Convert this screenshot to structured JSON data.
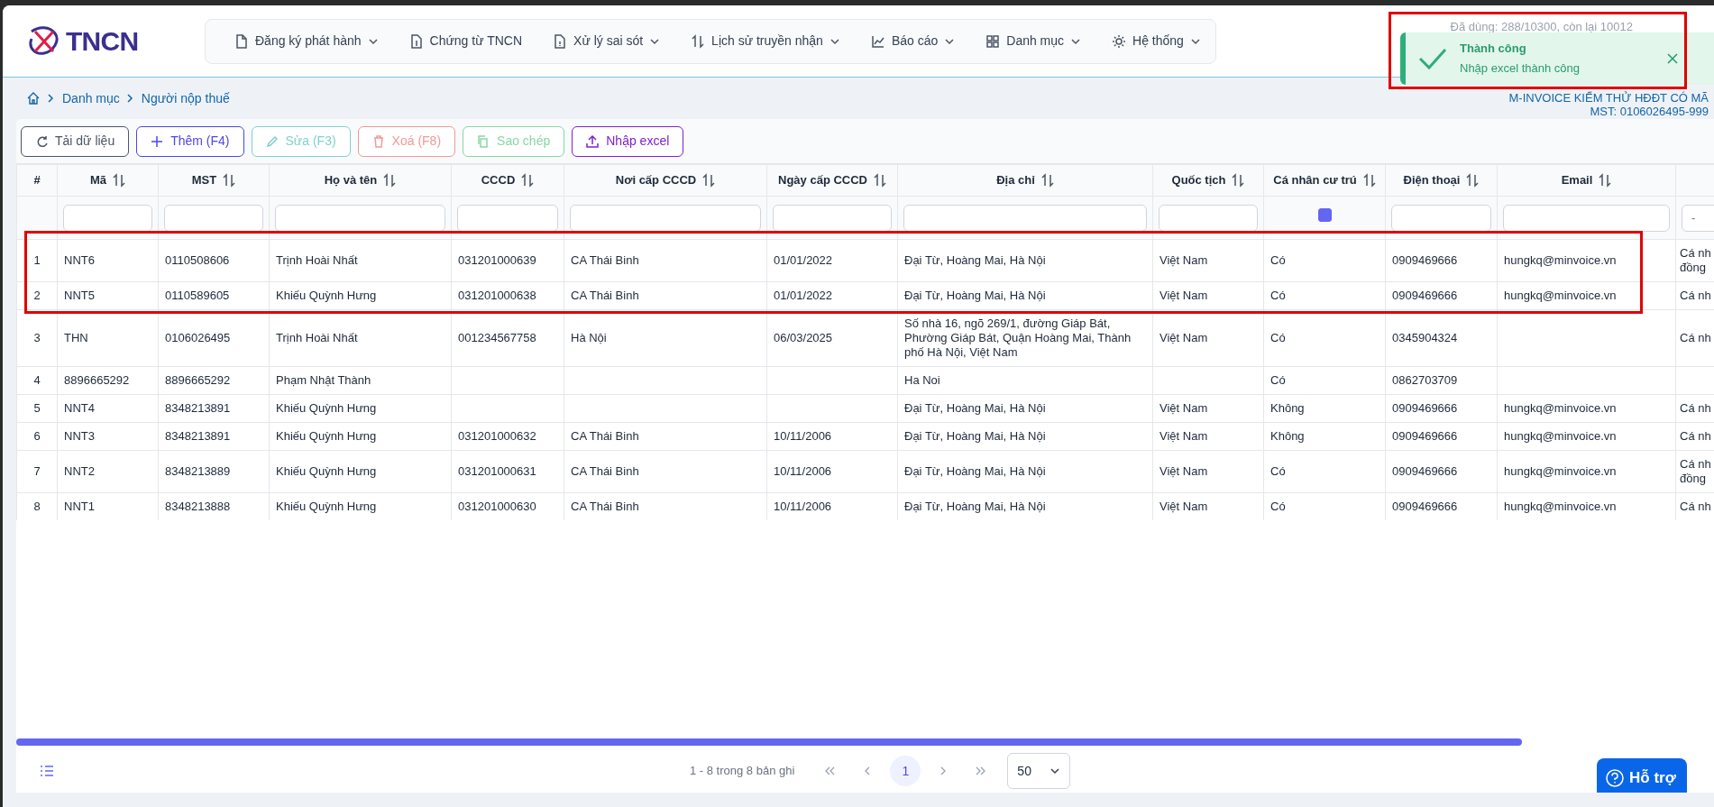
{
  "header": {
    "logo": "TNCN",
    "nav": [
      {
        "label": "Đăng ký phát hành",
        "has_dropdown": true
      },
      {
        "label": "Chứng từ TNCN",
        "has_dropdown": false
      },
      {
        "label": "Xử lý sai sót",
        "has_dropdown": true
      },
      {
        "label": "Lịch sử truyền nhận",
        "has_dropdown": true
      },
      {
        "label": "Báo cáo",
        "has_dropdown": true
      },
      {
        "label": "Danh mục",
        "has_dropdown": true
      },
      {
        "label": "Hệ thống",
        "has_dropdown": true
      }
    ],
    "usage": "Đã dùng: 288/10300, còn lại 10012"
  },
  "toast": {
    "title": "Thành công",
    "message": "Nhập excel thành công"
  },
  "breadcrumb": [
    "Danh mục",
    "Người nộp thuế"
  ],
  "company": {
    "name": "M-INVOICE KIỂM THỬ HĐĐT CÓ MÃ",
    "tax_code": "MST: 0106026495-999"
  },
  "toolbar": [
    {
      "label": "Tải dữ liệu",
      "color": "#4b5563"
    },
    {
      "label": "Thêm (F4)",
      "color": "#4f46e5"
    },
    {
      "label": "Sửa (F3)",
      "color": "#7fd3c9"
    },
    {
      "label": "Xoá (F8)",
      "color": "#f19999"
    },
    {
      "label": "Sao chép",
      "color": "#86d7a4"
    },
    {
      "label": "Nhập excel",
      "color": "#7e22ce"
    }
  ],
  "table": {
    "columns": [
      {
        "label": "#",
        "sortable": false
      },
      {
        "label": "Mã",
        "sortable": true,
        "filter": {
          "kind": "text"
        }
      },
      {
        "label": "MST",
        "sortable": true,
        "filter": {
          "kind": "text"
        }
      },
      {
        "label": "Họ và tên",
        "sortable": true,
        "filter": {
          "kind": "text"
        }
      },
      {
        "label": "CCCD",
        "sortable": true,
        "filter": {
          "kind": "text"
        }
      },
      {
        "label": "Nơi cấp CCCD",
        "sortable": true,
        "filter": {
          "kind": "text"
        }
      },
      {
        "label": "Ngày cấp CCCD",
        "sortable": true,
        "filter": {
          "kind": "text"
        }
      },
      {
        "label": "Địa chỉ",
        "sortable": true,
        "filter": {
          "kind": "text"
        }
      },
      {
        "label": "Quốc tịch",
        "sortable": true,
        "filter": {
          "kind": "text"
        }
      },
      {
        "label": "Cá nhân cư trú",
        "sortable": true,
        "filter": {
          "kind": "checkbox",
          "indeterminate": true
        }
      },
      {
        "label": "Điện thoại",
        "sortable": true,
        "filter": {
          "kind": "text"
        }
      },
      {
        "label": "Email",
        "sortable": true,
        "filter": {
          "kind": "text"
        }
      },
      {
        "sortable": false,
        "filter": {
          "kind": "select",
          "value": "-"
        }
      }
    ],
    "rows": [
      [
        "1",
        "NNT6",
        "0110508606",
        "Trịnh Hoài Nhất",
        "031201000639",
        "CA Thái Binh",
        "01/01/2022",
        "Đại Từ, Hoàng Mai, Hà Nội",
        "Việt Nam",
        "Có",
        "0909469666",
        "hungkq@minvoice.vn",
        "Cá nh\nđồng"
      ],
      [
        "2",
        "NNT5",
        "0110589605",
        "Khiếu Quỳnh Hưng",
        "031201000638",
        "CA Thái Binh",
        "01/01/2022",
        "Đại Từ, Hoàng Mai, Hà Nội",
        "Việt Nam",
        "Có",
        "0909469666",
        "hungkq@minvoice.vn",
        "Cá nh"
      ],
      [
        "3",
        "THN",
        "0106026495",
        "Trịnh Hoài Nhất",
        "001234567758",
        "Hà Nội",
        "06/03/2025",
        "Số nhà 16, ngõ 269/1, đường Giáp Bát, Phường Giáp Bát, Quận Hoàng Mai, Thành phố Hà Nội, Việt Nam",
        "Việt Nam",
        "Có",
        "0345904324",
        null,
        "Cá nh"
      ],
      [
        "4",
        "8896665292",
        "8896665292",
        "Phạm Nhật Thành",
        null,
        null,
        null,
        "Ha Noi",
        null,
        "Có",
        "0862703709",
        null,
        null
      ],
      [
        "5",
        "NNT4",
        "8348213891",
        "Khiếu Quỳnh Hưng",
        null,
        null,
        null,
        "Đại Từ, Hoàng Mai, Hà Nội",
        "Việt Nam",
        "Không",
        "0909469666",
        "hungkq@minvoice.vn",
        "Cá nh"
      ],
      [
        "6",
        "NNT3",
        "8348213891",
        "Khiếu Quỳnh Hưng",
        "031201000632",
        "CA Thái Binh",
        "10/11/2006",
        "Đại Từ, Hoàng Mai, Hà Nội",
        "Việt Nam",
        "Không",
        "0909469666",
        "hungkq@minvoice.vn",
        "Cá nh"
      ],
      [
        "7",
        "NNT2",
        "8348213889",
        "Khiếu Quỳnh Hưng",
        "031201000631",
        "CA Thái Binh",
        "10/11/2006",
        "Đại Từ, Hoàng Mai, Hà Nội",
        "Việt Nam",
        "Có",
        "0909469666",
        "hungkq@minvoice.vn",
        "Cá nh\nđồng"
      ],
      [
        "8",
        "NNT1",
        "8348213888",
        "Khiếu Quỳnh Hưng",
        "031201000630",
        "CA Thái Binh",
        "10/11/2006",
        "Đại Từ, Hoàng Mai, Hà Nội",
        "Việt Nam",
        "Có",
        "0909469666",
        "hungkq@minvoice.vn",
        "Cá nh"
      ]
    ]
  },
  "pagination": {
    "summary": "1 - 8 trong 8 bản ghi",
    "pages": [
      {
        "label": "1",
        "selected": true
      }
    ],
    "page_size": "50"
  },
  "help_button": "Hỗ trợ"
}
